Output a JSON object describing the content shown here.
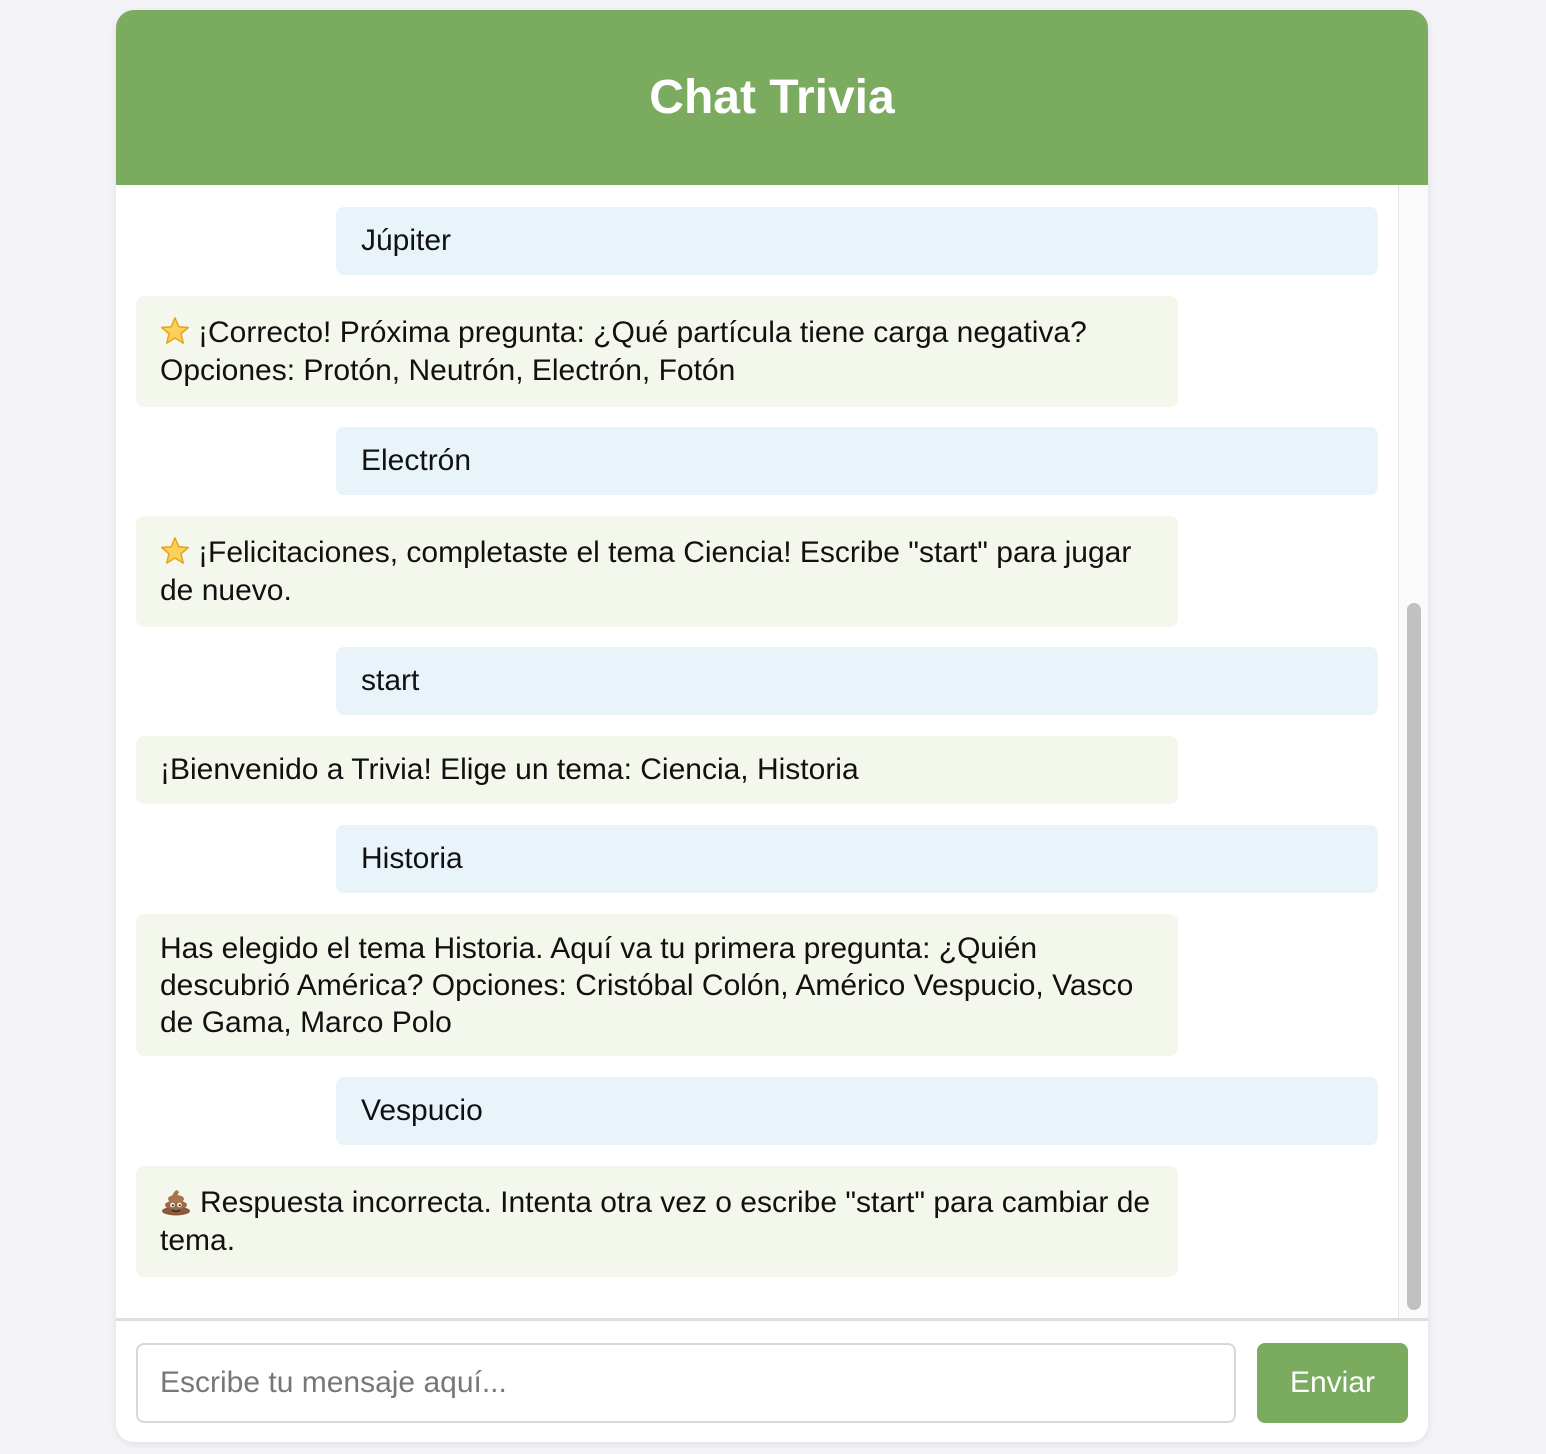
{
  "header": {
    "title": "Chat Trivia"
  },
  "messages": [
    {
      "sender": "user",
      "text": "Júpiter"
    },
    {
      "sender": "bot",
      "icon": "star-icon",
      "text": "¡Correcto! Próxima pregunta: ¿Qué partícula tiene carga negativa? Opciones: Protón, Neutrón, Electrón, Fotón"
    },
    {
      "sender": "user",
      "text": "Electrón"
    },
    {
      "sender": "bot",
      "icon": "star-icon",
      "text": "¡Felicitaciones, completaste el tema Ciencia! Escribe \"start\" para jugar de nuevo."
    },
    {
      "sender": "user",
      "text": "start"
    },
    {
      "sender": "bot",
      "text": "¡Bienvenido a Trivia! Elige un tema: Ciencia, Historia"
    },
    {
      "sender": "user",
      "text": "Historia"
    },
    {
      "sender": "bot",
      "text": "Has elegido el tema Historia. Aquí va tu primera pregunta: ¿Quién descubrió América? Opciones: Cristóbal Colón, Américo Vespucio, Vasco de Gama, Marco Polo"
    },
    {
      "sender": "user",
      "text": "Vespucio"
    },
    {
      "sender": "bot",
      "icon": "poop-icon",
      "text": "Respuesta incorrecta. Intenta otra vez o escribe \"start\" para cambiar de tema."
    }
  ],
  "input": {
    "placeholder": "Escribe tu mensaje aquí...",
    "value": ""
  },
  "send_button": {
    "label": "Enviar"
  },
  "colors": {
    "accent": "#7bab5f",
    "user_bubble": "#e8f4fa",
    "bot_bubble": "#f3f7ec",
    "page_background": "#f3f3f7"
  }
}
